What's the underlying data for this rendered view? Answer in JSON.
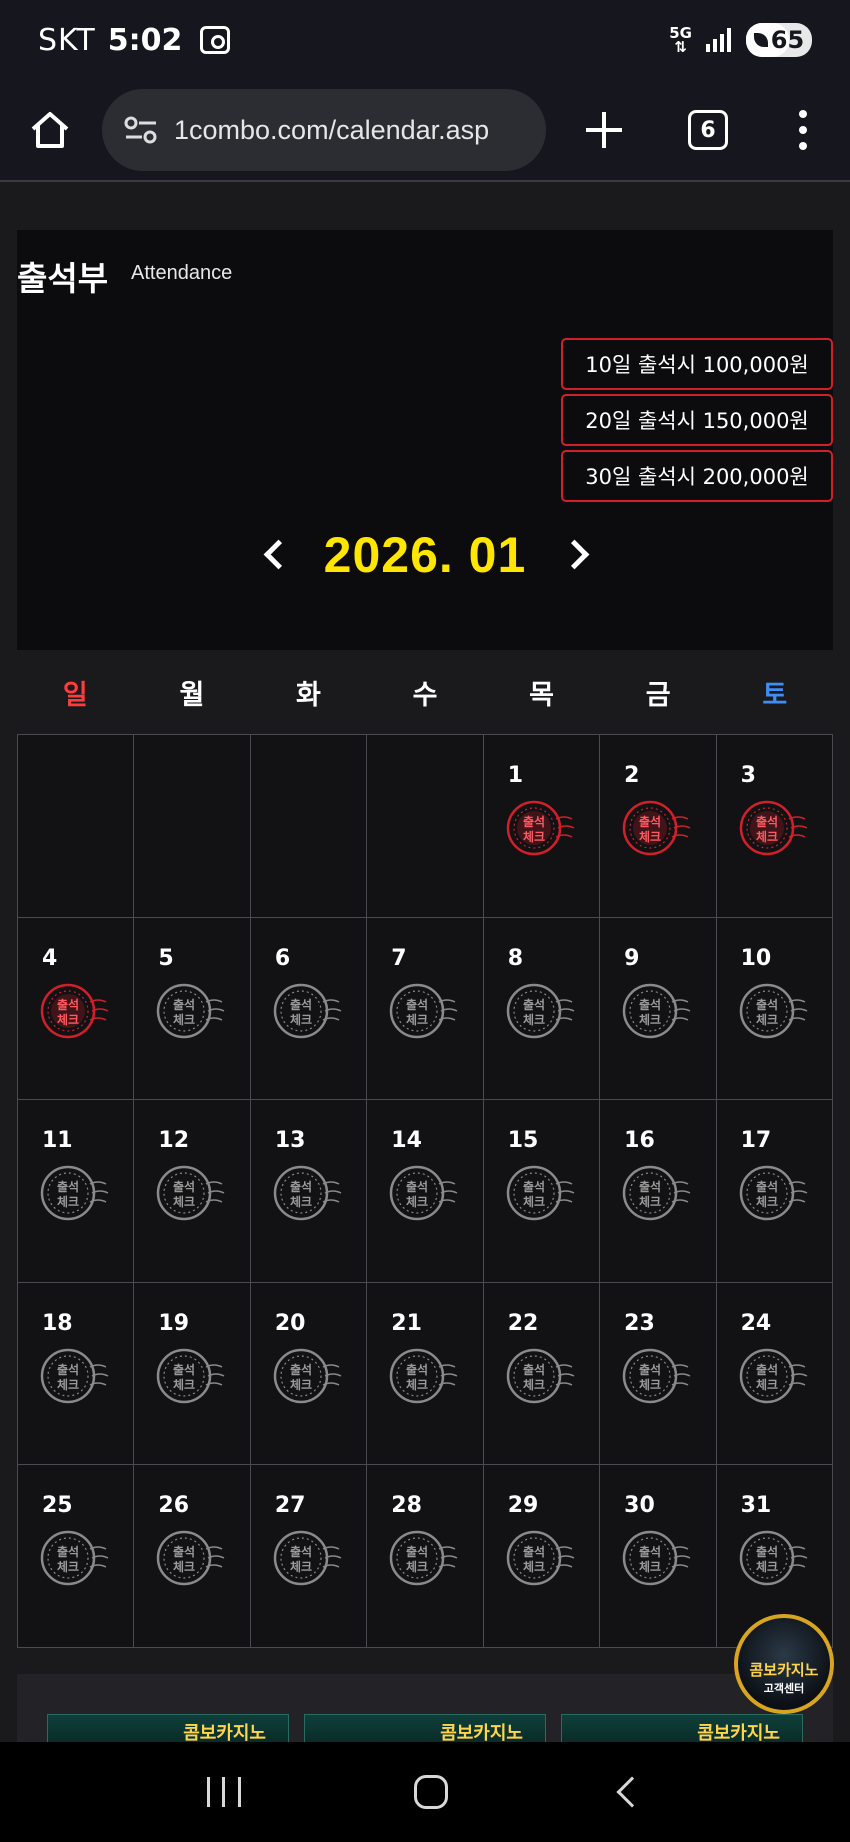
{
  "status_bar": {
    "carrier": "SKT",
    "time": "5:02",
    "network": "5G",
    "battery": "65",
    "battery_level": 0.65
  },
  "browser": {
    "url": "1combo.com/calendar.asp",
    "tab_count": "6"
  },
  "page": {
    "title": "출석부",
    "subtitle": "Attendance",
    "rewards": [
      "10일 출석시 100,000원",
      "20일 출석시 150,000원",
      "30일 출석시 200,000원"
    ],
    "month_label": "2026. 01",
    "weekdays": [
      "일",
      "월",
      "화",
      "수",
      "목",
      "금",
      "토"
    ],
    "stamp_text": [
      "출석",
      "체크"
    ],
    "stamp_colors": {
      "checked": "#d1202a",
      "unchecked": "#8a8a8a"
    },
    "leading_blank_days": 4,
    "days": [
      {
        "d": "1",
        "checked": true
      },
      {
        "d": "2",
        "checked": true
      },
      {
        "d": "3",
        "checked": true
      },
      {
        "d": "4",
        "checked": true
      },
      {
        "d": "5",
        "checked": false
      },
      {
        "d": "6",
        "checked": false
      },
      {
        "d": "7",
        "checked": false
      },
      {
        "d": "8",
        "checked": false
      },
      {
        "d": "9",
        "checked": false
      },
      {
        "d": "10",
        "checked": false
      },
      {
        "d": "11",
        "checked": false
      },
      {
        "d": "12",
        "checked": false
      },
      {
        "d": "13",
        "checked": false
      },
      {
        "d": "14",
        "checked": false
      },
      {
        "d": "15",
        "checked": false
      },
      {
        "d": "16",
        "checked": false
      },
      {
        "d": "17",
        "checked": false
      },
      {
        "d": "18",
        "checked": false
      },
      {
        "d": "19",
        "checked": false
      },
      {
        "d": "20",
        "checked": false
      },
      {
        "d": "21",
        "checked": false
      },
      {
        "d": "22",
        "checked": false
      },
      {
        "d": "23",
        "checked": false
      },
      {
        "d": "24",
        "checked": false
      },
      {
        "d": "25",
        "checked": false
      },
      {
        "d": "26",
        "checked": false
      },
      {
        "d": "27",
        "checked": false
      },
      {
        "d": "28",
        "checked": false
      },
      {
        "d": "29",
        "checked": false
      },
      {
        "d": "30",
        "checked": false
      },
      {
        "d": "31",
        "checked": false
      }
    ],
    "banner_text": "콤보카지노",
    "support_badge": {
      "line1": "콤보카지노",
      "line2": "고객센터"
    }
  },
  "icons": {
    "home": "home-icon",
    "site_settings": "tune-icon",
    "new_tab": "plus-icon",
    "tabs": "tabs-icon",
    "menu": "more-vert-icon",
    "prev_month": "chevron-left-icon",
    "next_month": "chevron-right-icon"
  }
}
